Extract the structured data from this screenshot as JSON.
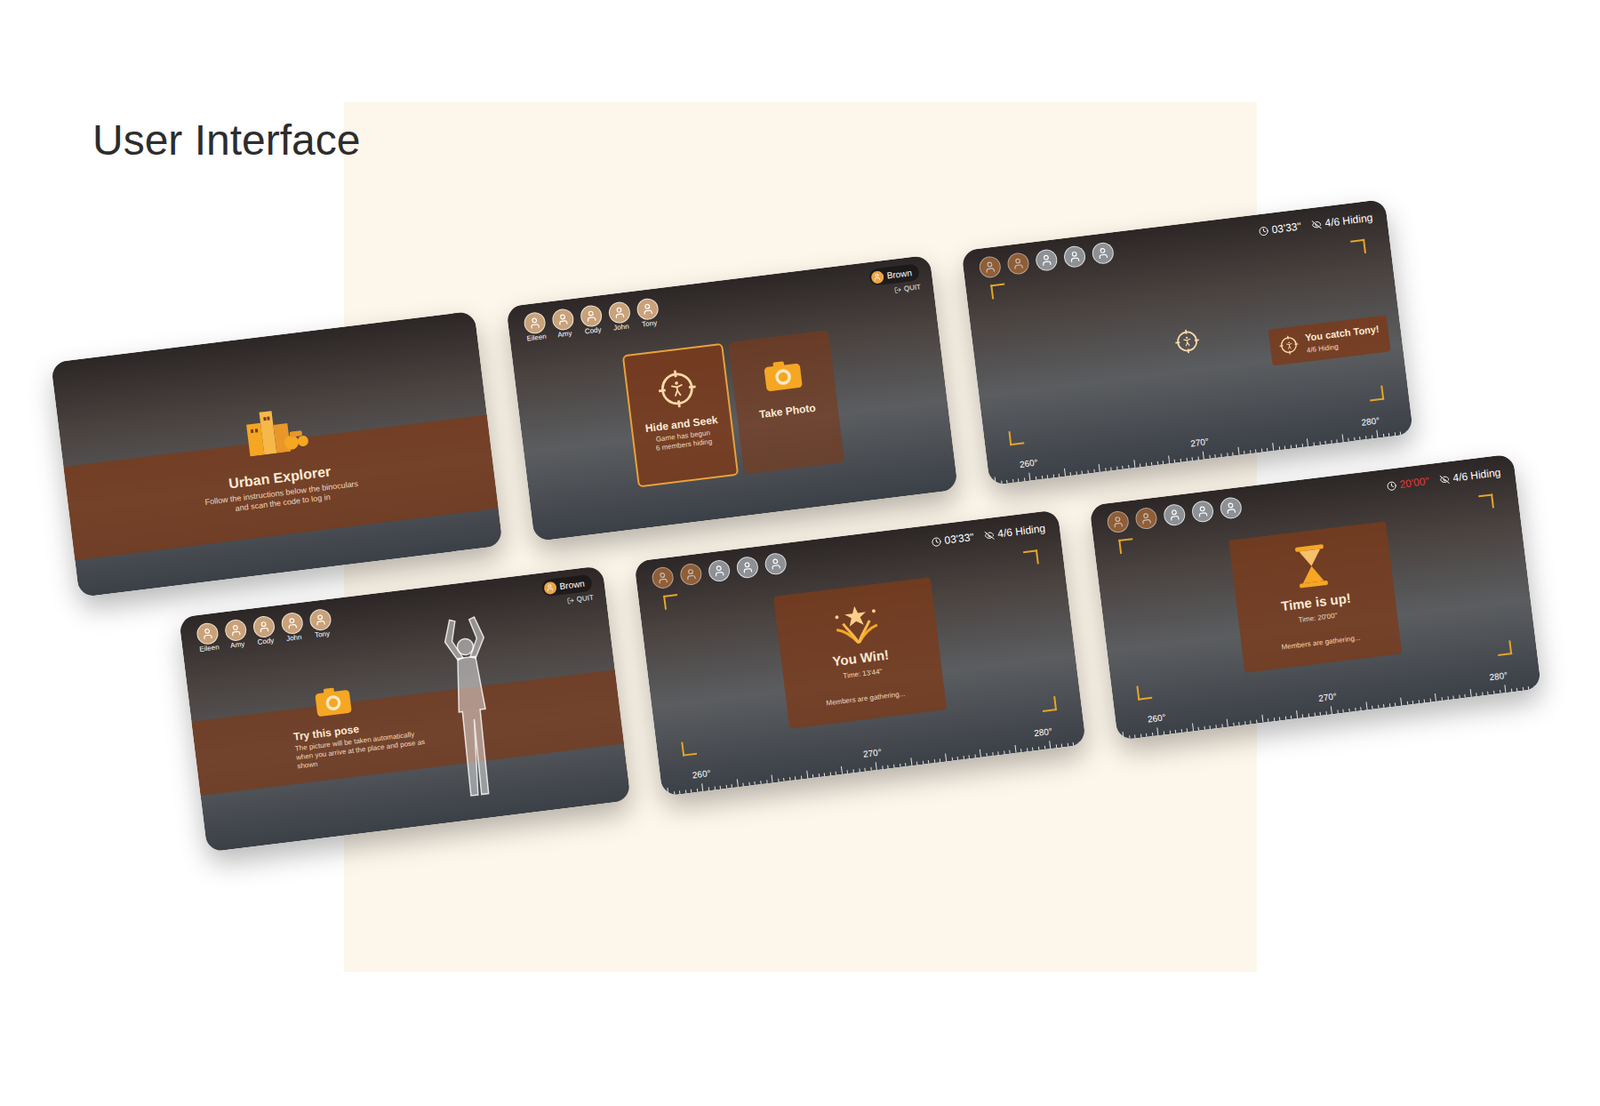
{
  "page": {
    "title": "User Interface"
  },
  "screens": [
    {
      "kind": "intro",
      "title": "Urban Explorer",
      "lines": [
        "Follow the instructions below the binoculars",
        "and scan the code to log in"
      ]
    },
    {
      "kind": "menu",
      "players": [
        {
          "name": "Eileen"
        },
        {
          "name": "Amy"
        },
        {
          "name": "Cody"
        },
        {
          "name": "John"
        },
        {
          "name": "Tony"
        }
      ],
      "user": {
        "name": "Brown",
        "quit": "QUIT"
      },
      "options": [
        {
          "kind": "seek",
          "title": "Hide and Seek",
          "lines": [
            "Game has begun",
            "6 members hiding"
          ],
          "selected": true
        },
        {
          "kind": "photo",
          "title": "Take Photo",
          "lines": [],
          "selected": false
        }
      ]
    },
    {
      "kind": "game",
      "timer": "03'33\"",
      "expired": false,
      "hiding": "4/6 Hiding",
      "players": [
        {
          "caught": true
        },
        {
          "caught": true
        },
        {
          "caught": false
        },
        {
          "caught": false
        },
        {
          "caught": false
        }
      ],
      "toast": {
        "title": "You catch Tony!",
        "sub": "4/6 Hiding"
      },
      "compass": [
        "260°",
        "270°",
        "280°"
      ]
    },
    {
      "kind": "pose",
      "players": [
        {
          "name": "Eileen"
        },
        {
          "name": "Amy"
        },
        {
          "name": "Cody"
        },
        {
          "name": "John"
        },
        {
          "name": "Tony"
        }
      ],
      "user": {
        "name": "Brown",
        "quit": "QUIT"
      },
      "title": "Try this pose",
      "text": "The picture will be taken automatically when you arrive at the place and pose as shown"
    },
    {
      "kind": "win",
      "timer": "03'33\"",
      "expired": false,
      "hiding": "4/6 Hiding",
      "players": [
        {
          "caught": true
        },
        {
          "caught": true
        },
        {
          "caught": false
        },
        {
          "caught": false
        },
        {
          "caught": false
        }
      ],
      "title": "You Win!",
      "time": "Time: 13'44\"",
      "note": "Members are gathering...",
      "compass": [
        "260°",
        "270°",
        "280°"
      ]
    },
    {
      "kind": "timeout",
      "timer": "20'00\"",
      "expired": true,
      "hiding": "4/6 Hiding",
      "players": [
        {
          "caught": true
        },
        {
          "caught": true
        },
        {
          "caught": false
        },
        {
          "caught": false
        },
        {
          "caught": false
        }
      ],
      "title": "Time is up!",
      "time": "Time: 20'00\"",
      "note": "Members are gathering...",
      "compass": [
        "260°",
        "270°",
        "280°"
      ]
    }
  ]
}
